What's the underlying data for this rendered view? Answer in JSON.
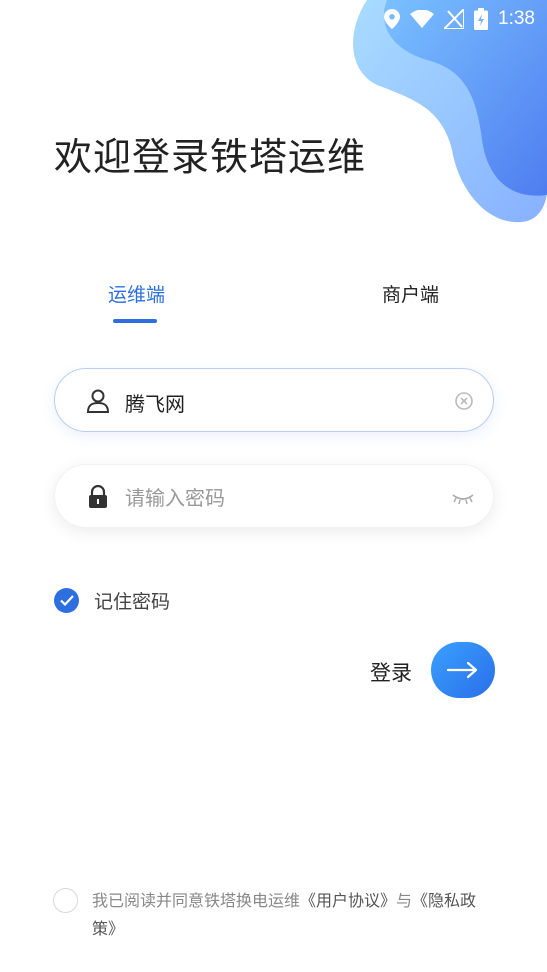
{
  "status_bar": {
    "time": "1:38"
  },
  "title": "欢迎登录铁塔运维",
  "tabs": [
    {
      "label": "运维端",
      "active": true
    },
    {
      "label": "商户端",
      "active": false
    }
  ],
  "username": {
    "value": "腾飞网"
  },
  "password": {
    "placeholder": "请输入密码"
  },
  "remember": {
    "label": "记住密码",
    "checked": true
  },
  "login": {
    "label": "登录"
  },
  "agreement": {
    "prefix": "我已阅读并同意铁塔换电运维",
    "user_agreement": "《用户协议》",
    "conjunction": "与",
    "privacy_policy": "《隐私政策》",
    "checked": false
  },
  "colors": {
    "accent": "#2e6fe0",
    "blob_light": "#8fd0ff",
    "blob_dark": "#5b8af0"
  }
}
